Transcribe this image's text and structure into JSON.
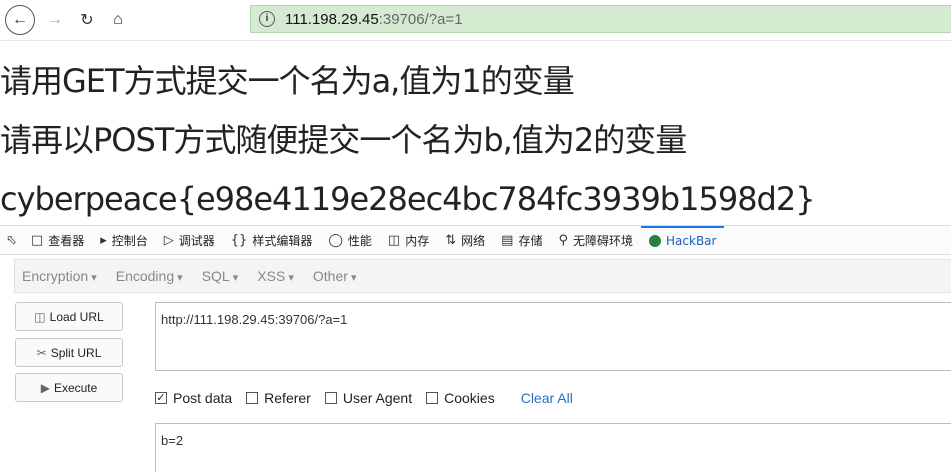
{
  "browser": {
    "url_host": "111.198.29.45",
    "url_rest": ":39706/?a=1"
  },
  "page": {
    "lines": [
      "请用GET方式提交一个名为a,值为1的变量",
      "请再以POST方式随便提交一个名为b,值为2的变量",
      "cyberpeace{e98e4119e28ec4bc784fc3939b1598d2}"
    ]
  },
  "devtools": {
    "tabs": [
      "查看器",
      "控制台",
      "调试器",
      "样式编辑器",
      "性能",
      "内存",
      "网络",
      "存储",
      "无障碍环境",
      "HackBar"
    ]
  },
  "hackbar": {
    "menus": [
      "Encryption",
      "Encoding",
      "SQL",
      "XSS",
      "Other"
    ],
    "load_url": "Load URL",
    "split_url": "Split URL",
    "execute": "Execute",
    "url_value": "http://111.198.29.45:39706/?a=1",
    "options": [
      {
        "label": "Post data",
        "checked": true
      },
      {
        "label": "Referer",
        "checked": false
      },
      {
        "label": "User Agent",
        "checked": false
      },
      {
        "label": "Cookies",
        "checked": false
      }
    ],
    "clear_all": "Clear All",
    "post_value": "b=2"
  }
}
